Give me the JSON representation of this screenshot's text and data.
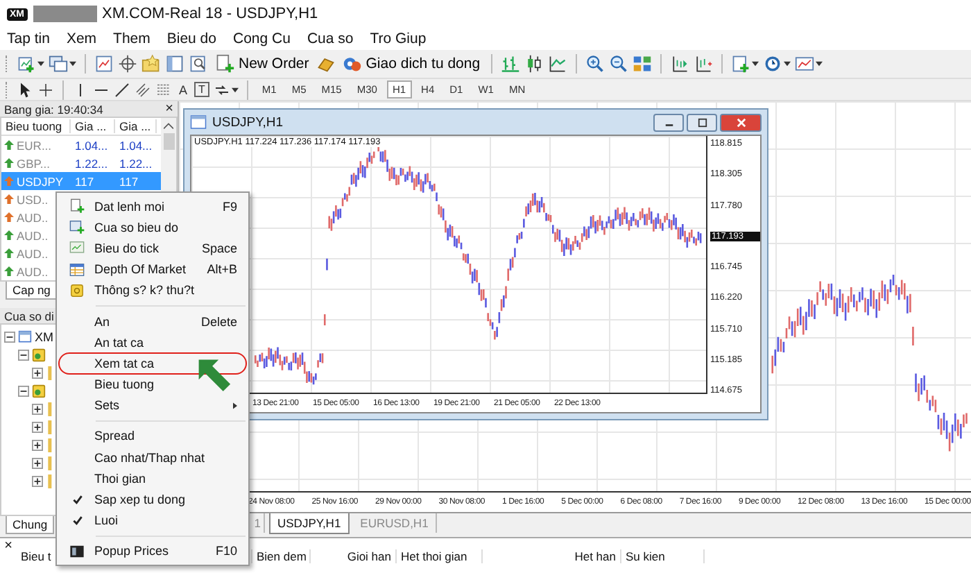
{
  "window": {
    "logo": "XM",
    "title": "XM.COM-Real 18 - USDJPY,H1"
  },
  "menu_bar": [
    "Tap tin",
    "Xem",
    "Them",
    "Bieu do",
    "Cong Cu",
    "Cua so",
    "Tro Giup"
  ],
  "toolbar": {
    "buttons": [
      "New Order",
      "Giao dich tu dong"
    ]
  },
  "drawing_toolbar": {
    "text_tools": [
      "A",
      "T"
    ],
    "timeframes": [
      {
        "label": "M1",
        "selected": false
      },
      {
        "label": "M5",
        "selected": false
      },
      {
        "label": "M15",
        "selected": false
      },
      {
        "label": "M30",
        "selected": false
      },
      {
        "label": "H1",
        "selected": true
      },
      {
        "label": "H4",
        "selected": false
      },
      {
        "label": "D1",
        "selected": false
      },
      {
        "label": "W1",
        "selected": false
      },
      {
        "label": "MN",
        "selected": false
      }
    ]
  },
  "market_watch": {
    "title": "Bang gia: 19:40:34",
    "close": "×",
    "columns": [
      "Bieu tuong",
      "Gia ...",
      "Gia ..."
    ],
    "rows": [
      {
        "symbol": "EUR...",
        "bid": "1.04...",
        "ask": "1.04...",
        "color": "#3a9e3a",
        "selected": false
      },
      {
        "symbol": "GBP...",
        "bid": "1.22...",
        "ask": "1.22...",
        "color": "#3a9e3a",
        "selected": false
      },
      {
        "symbol": "USDJPY",
        "bid": "117",
        "ask": "117",
        "color": "#e0702a",
        "selected": true
      },
      {
        "symbol": "USD..",
        "color": "#e0702a",
        "selected": false
      },
      {
        "symbol": "AUD..",
        "color": "#e0702a",
        "selected": false
      },
      {
        "symbol": "AUD..",
        "color": "#3a9e3a",
        "selected": false
      },
      {
        "symbol": "AUD..",
        "color": "#3a9e3a",
        "selected": false
      },
      {
        "symbol": "AUD..",
        "color": "#3a9e3a",
        "selected": false
      }
    ],
    "tab": "Cap ng"
  },
  "navigator": {
    "title": "Cua so di",
    "tree": [
      {
        "label": "XM",
        "expanded": true,
        "children": [
          {
            "expanded": true,
            "children": [
              {
                "expanded": false
              }
            ]
          },
          {
            "expanded": true,
            "children": [
              {
                "expanded": false
              },
              {
                "expanded": false
              },
              {
                "expanded": false
              },
              {
                "expanded": false
              },
              {
                "expanded": false
              }
            ]
          }
        ]
      }
    ],
    "tab": "Chung"
  },
  "chart": {
    "x_labels": [
      "24 Nov 08:00",
      "25 Nov 16:00",
      "29 Nov 00:00",
      "30 Nov 08:00",
      "1 Dec 16:00",
      "5 Dec 00:00",
      "6 Dec 08:00",
      "7 Dec 16:00",
      "9 Dec 00:00",
      "12 Dec 08:00",
      "13 Dec 16:00",
      "15 Dec 00:00"
    ],
    "tabs": [
      {
        "label": "1",
        "selected": false
      },
      {
        "label": "USDJPY,H1",
        "selected": true
      },
      {
        "label": "EURUSD,H1",
        "selected": false
      }
    ]
  },
  "chart_window": {
    "title": "USDJPY,H1",
    "info": "USDJPY.H1 117.224 117.236 117.174 117.193",
    "y_labels": [
      "118.815",
      "118.305",
      "117.780",
      "116.745",
      "116.220",
      "115.710",
      "115.185",
      "114.675"
    ],
    "price": "117.193",
    "x_labels": [
      "13 Dec 21:00",
      "15 Dec 05:00",
      "16 Dec 13:00",
      "19 Dec 21:00",
      "21 Dec 05:00",
      "22 Dec 13:00"
    ]
  },
  "context_menu": {
    "items": [
      {
        "kind": "item",
        "label": "Dat lenh moi",
        "shortcut": "F9",
        "checked": false,
        "selected": false,
        "submenu": false
      },
      {
        "kind": "item",
        "label": "Cua so bieu do",
        "checked": false,
        "selected": false,
        "submenu": false
      },
      {
        "kind": "item",
        "label": "Bieu do tick",
        "shortcut": "Space",
        "checked": false,
        "selected": false,
        "submenu": false
      },
      {
        "kind": "item",
        "label": "Depth Of Market",
        "shortcut": "Alt+B",
        "checked": false,
        "selected": false,
        "submenu": false
      },
      {
        "kind": "item",
        "label": "Thông s? k? thu?t",
        "checked": false,
        "selected": false,
        "submenu": false
      },
      {
        "kind": "separator"
      },
      {
        "kind": "item",
        "label": "An",
        "shortcut": "Delete",
        "checked": false,
        "selected": false,
        "submenu": false
      },
      {
        "kind": "item",
        "label": "An tat ca",
        "checked": false,
        "selected": false,
        "submenu": false
      },
      {
        "kind": "item",
        "label": "Xem tat ca",
        "checked": false,
        "selected": true,
        "submenu": false
      },
      {
        "kind": "item",
        "label": "Bieu tuong",
        "checked": false,
        "selected": false,
        "submenu": false
      },
      {
        "kind": "item",
        "label": "Sets",
        "checked": false,
        "selected": false,
        "submenu": true
      },
      {
        "kind": "separator"
      },
      {
        "kind": "item",
        "label": "Spread",
        "checked": false,
        "selected": false,
        "submenu": false
      },
      {
        "kind": "item",
        "label": "Cao nhat/Thap nhat",
        "checked": false,
        "selected": false,
        "submenu": false
      },
      {
        "kind": "item",
        "label": "Thoi gian",
        "checked": false,
        "selected": false,
        "submenu": false
      },
      {
        "kind": "item",
        "label": "Sap xep tu dong",
        "checked": true,
        "selected": false,
        "submenu": false
      },
      {
        "kind": "item",
        "label": "Luoi",
        "checked": true,
        "selected": false,
        "submenu": false
      },
      {
        "kind": "separator"
      },
      {
        "kind": "item",
        "label": "Popup Prices",
        "shortcut": "F10",
        "checked": false,
        "selected": false,
        "submenu": false
      }
    ]
  },
  "terminal": {
    "close": "×",
    "columns": [
      "Bieu t",
      "Bien dem",
      "Gioi han",
      "Het thoi gian",
      "Het han",
      "Su kien"
    ]
  }
}
